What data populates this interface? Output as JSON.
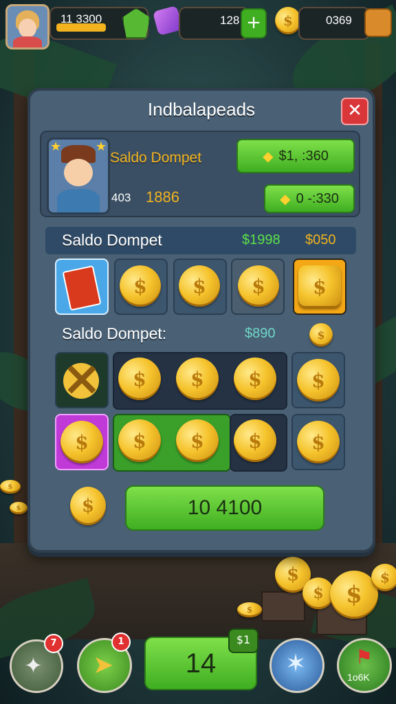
{
  "hud": {
    "player_level_value": "11 3300",
    "gems_value": "128",
    "coins_value": "0369"
  },
  "panel": {
    "title": "Indbalapeads",
    "close_label": "✕",
    "profile": {
      "name": "Saldo Dompet",
      "stat_label": "403",
      "stat_value": "1886",
      "button_top": "$1, :360",
      "button_bottom": "0 -:330"
    },
    "section1": {
      "label": "Saldo Dompet",
      "value_green": "$1998",
      "value_gold": "$050"
    },
    "section2": {
      "label": "Saldo Dompet:",
      "value": "$890"
    },
    "claim_button": "10 4100"
  },
  "bottom_bar": {
    "left_badge_1": "7",
    "left_badge_2": "1",
    "center_value": "14",
    "center_badge": "$1",
    "right_label": "1o6K"
  },
  "colors": {
    "panel_bg": "#4a6175",
    "green_button": "#3fae21",
    "gold": "#f5c32c",
    "close_red": "#d9363a"
  }
}
